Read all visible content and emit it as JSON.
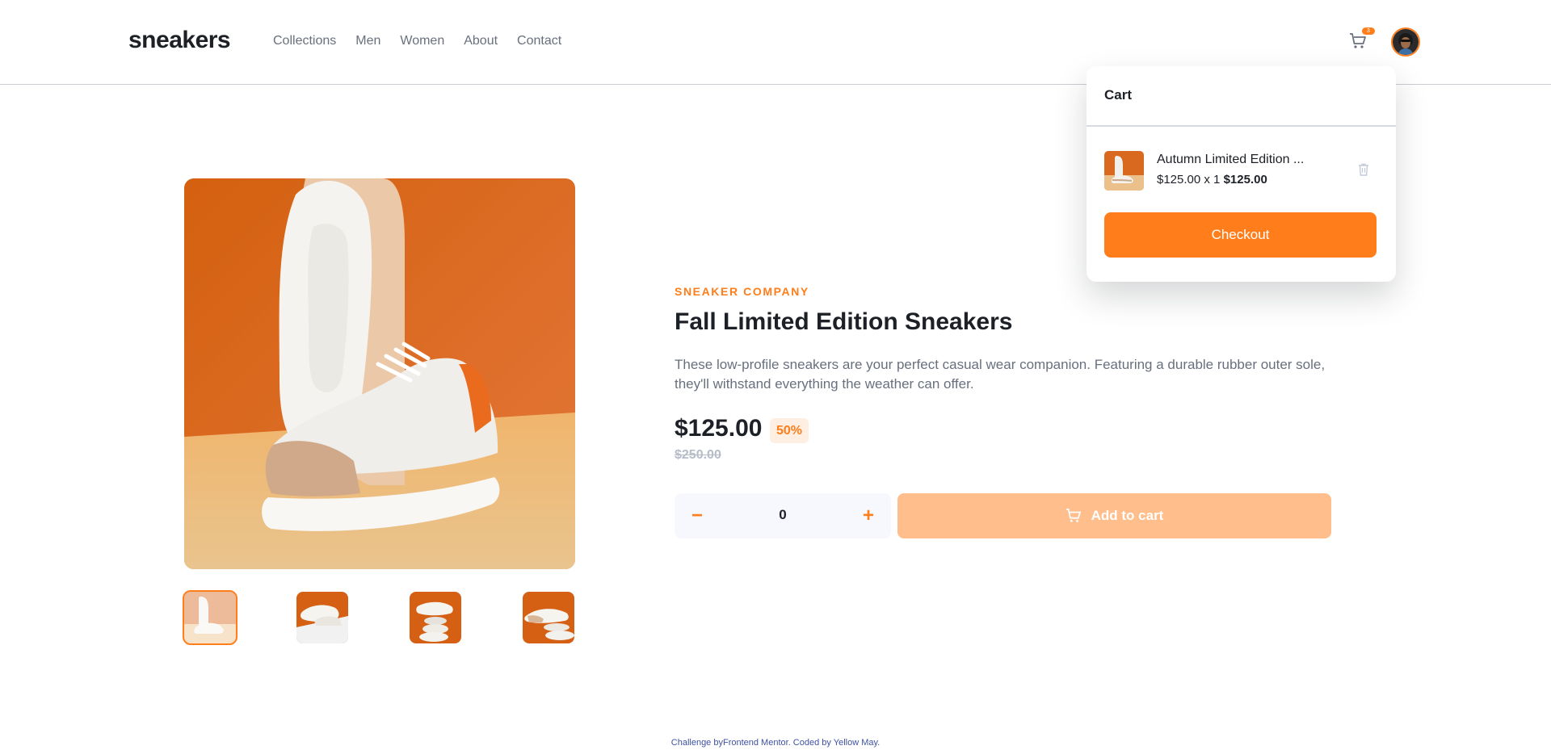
{
  "header": {
    "logo": "sneakers",
    "nav": [
      "Collections",
      "Men",
      "Women",
      "About",
      "Contact"
    ],
    "cart_count": "3"
  },
  "cart": {
    "title": "Cart",
    "item": {
      "name": "Autumn Limited Edition ...",
      "unit_price_qty": "$125.00 x 1",
      "total": "$125.00"
    },
    "checkout_label": "Checkout"
  },
  "product": {
    "company": "SNEAKER COMPANY",
    "title": "Fall Limited Edition Sneakers",
    "description": "These low-profile sneakers are your perfect casual wear companion. Featuring a durable rubber outer sole, they'll withstand everything the weather can offer.",
    "price": "$125.00",
    "discount": "50%",
    "old_price": "$250.00",
    "quantity": "0",
    "minus_symbol": "−",
    "plus_symbol": "+",
    "add_to_cart_label": "Add to cart"
  },
  "footer": {
    "text": "Challenge byFrontend Mentor. Coded by Yellow May."
  },
  "colors": {
    "accent": "#ff7e1b",
    "accent_pale": "#ffeee2",
    "add_btn_disabled": "#ffbe8c",
    "text_dark": "#1d2026",
    "text_grey": "#69707d"
  },
  "icons": [
    "cart-icon",
    "avatar",
    "trash-icon",
    "minus-icon",
    "plus-icon"
  ]
}
